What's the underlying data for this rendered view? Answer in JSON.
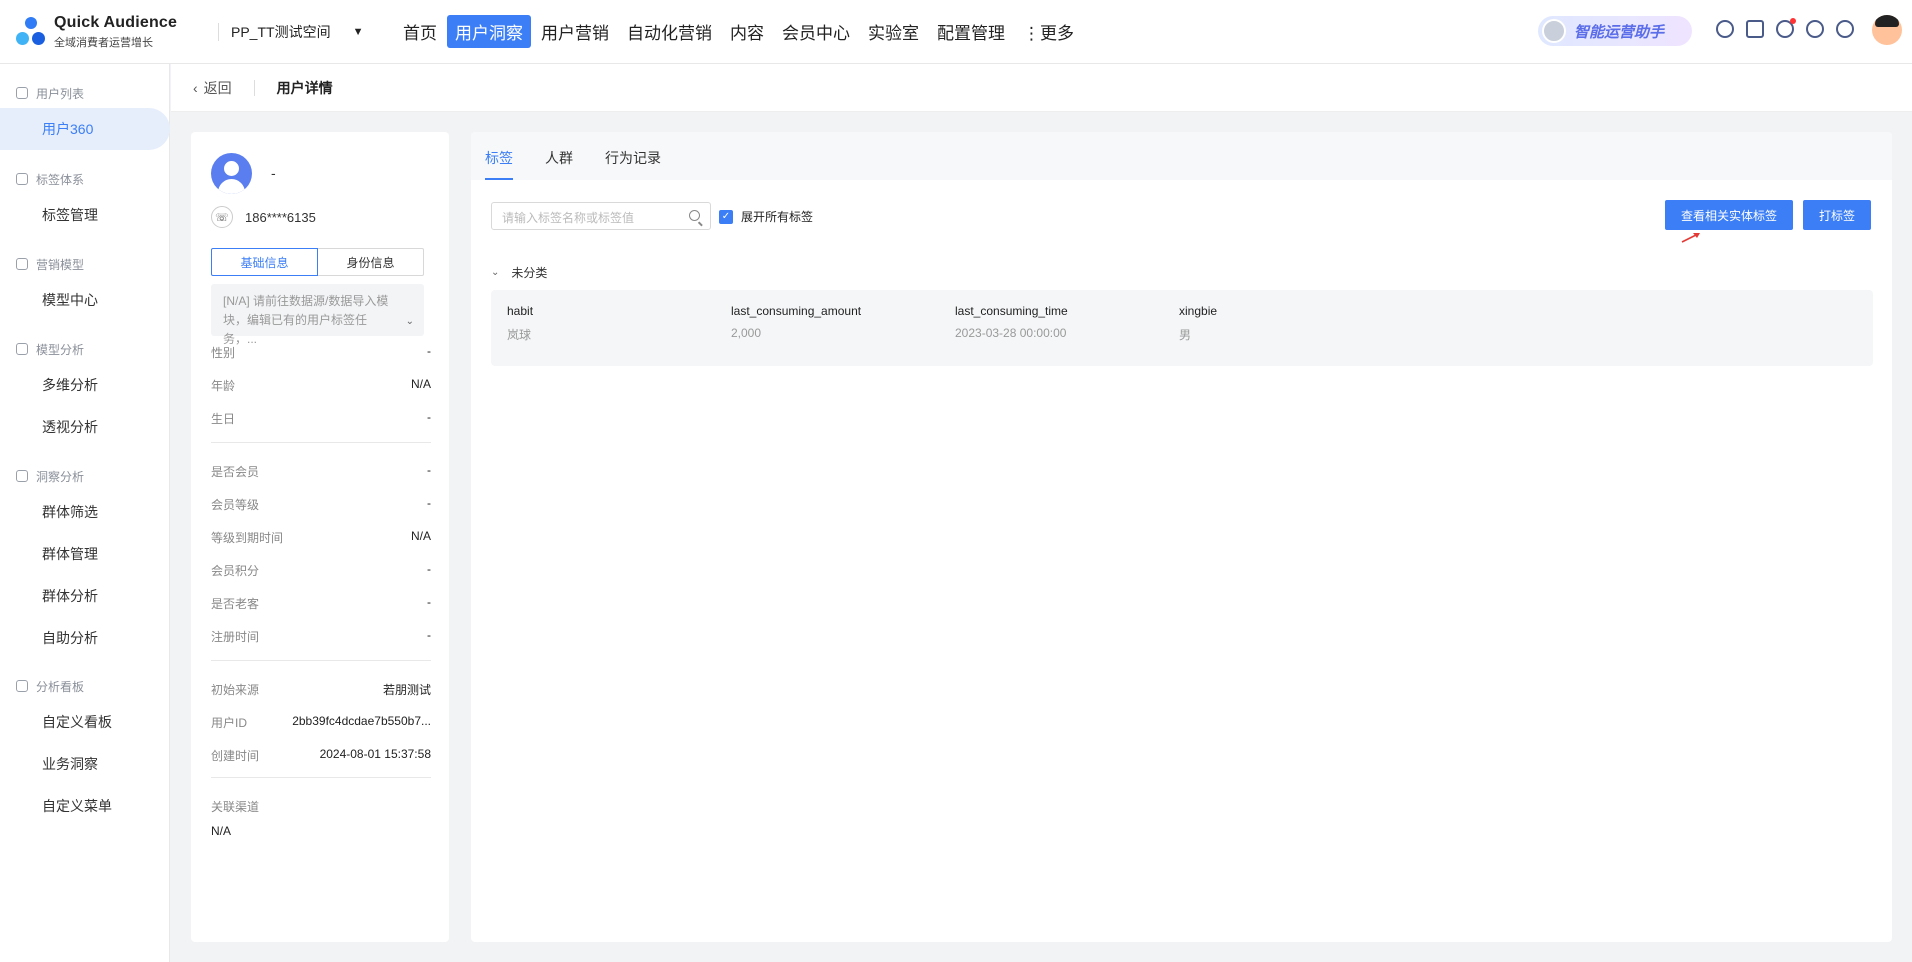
{
  "header": {
    "brand": "Quick Audience",
    "brand_sub": "全域消費者运营增长",
    "workspace": "PP_TT测试空间",
    "nav": [
      {
        "label": "首页",
        "active": false
      },
      {
        "label": "用户洞察",
        "active": true
      },
      {
        "label": "用户营销",
        "active": false
      },
      {
        "label": "自动化营销",
        "active": false
      },
      {
        "label": "内容",
        "active": false
      },
      {
        "label": "会员中心",
        "active": false
      },
      {
        "label": "实验室",
        "active": false
      },
      {
        "label": "配置管理",
        "active": false
      },
      {
        "label": "⋮更多",
        "active": false
      }
    ],
    "assistant": "智能运营助手"
  },
  "sidebar": {
    "groups": [
      {
        "label": "用户列表",
        "items": [
          {
            "label": "用户360",
            "active": true
          }
        ]
      },
      {
        "label": "标签体系",
        "items": [
          {
            "label": "标签管理"
          }
        ]
      },
      {
        "label": "营销模型",
        "items": [
          {
            "label": "模型中心"
          }
        ]
      },
      {
        "label": "模型分析",
        "items": [
          {
            "label": "多维分析"
          },
          {
            "label": "透视分析"
          }
        ]
      },
      {
        "label": "洞察分析",
        "items": [
          {
            "label": "群体筛选"
          },
          {
            "label": "群体管理"
          },
          {
            "label": "群体分析"
          },
          {
            "label": "自助分析"
          }
        ]
      },
      {
        "label": "分析看板",
        "items": [
          {
            "label": "自定义看板"
          },
          {
            "label": "业务洞察"
          },
          {
            "label": "自定义菜单"
          }
        ]
      }
    ]
  },
  "breadcrumb": {
    "back": "返回",
    "title": "用户详情"
  },
  "profile": {
    "name": "-",
    "phone": "186****6135",
    "tabs": [
      "基础信息",
      "身份信息"
    ],
    "note": "[N/A] 请前往数据源/数据导入模块，编辑已有的用户标签任务，...",
    "section1": [
      {
        "k": "性别",
        "v": "-"
      },
      {
        "k": "年龄",
        "v": "N/A"
      },
      {
        "k": "生日",
        "v": "-"
      }
    ],
    "section2": [
      {
        "k": "是否会员",
        "v": "-"
      },
      {
        "k": "会员等级",
        "v": "-"
      },
      {
        "k": "等级到期时间",
        "v": "N/A"
      },
      {
        "k": "会员积分",
        "v": "-"
      },
      {
        "k": "是否老客",
        "v": "-"
      },
      {
        "k": "注册时间",
        "v": "-"
      }
    ],
    "section3": [
      {
        "k": "初始来源",
        "v": "若朋测试"
      },
      {
        "k": "用户ID",
        "v": "2bb39fc4dcdae7b550b7..."
      },
      {
        "k": "创建时间",
        "v": "2024-08-01 15:37:58"
      }
    ],
    "channel_label": "关联渠道",
    "channel_value": "N/A"
  },
  "main": {
    "tabs": [
      "标签",
      "人群",
      "行为记录"
    ],
    "search_placeholder": "请输入标签名称或标签值",
    "expand_all": "展开所有标签",
    "btn_related": "查看相关实体标签",
    "btn_tag": "打标签",
    "category": "未分类",
    "tags": [
      {
        "key": "habit",
        "value": "岚球"
      },
      {
        "key": "last_consuming_amount",
        "value": "2,000"
      },
      {
        "key": "last_consuming_time",
        "value": "2023-03-28 00:00:00"
      },
      {
        "key": "xingbie",
        "value": "男"
      }
    ],
    "accent": "#3b7ef6"
  }
}
